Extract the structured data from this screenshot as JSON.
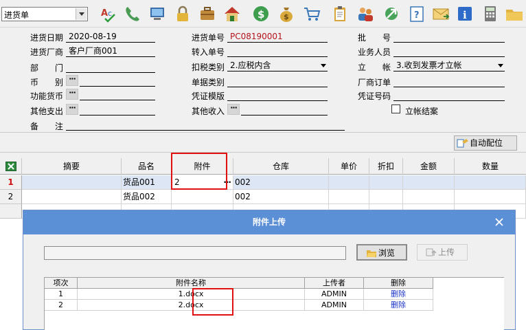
{
  "toolbar": {
    "doc_type": "进货单",
    "icons": [
      "spell-check-icon",
      "phone-icon",
      "monitor-icon",
      "lock-icon",
      "briefcase-icon",
      "house-icon",
      "dollar-icon",
      "money-bag-icon",
      "cart-icon",
      "clipboard-icon",
      "users-icon",
      "zoom-icon",
      "help-icon",
      "mail-icon",
      "info-icon",
      "calculator-icon",
      "folder-icon"
    ]
  },
  "form": {
    "purchase_date_label": "进货日期",
    "purchase_date": "2020-08-19",
    "vendor_label": "进货厂商",
    "vendor": "客户厂商001",
    "dept_label": "部　　门",
    "currency_label": "币　　别",
    "functional_currency_label": "功能货币",
    "other_expense_label": "其他支出",
    "remark_label": "备　　注",
    "order_no_label": "进货单号",
    "order_no": "PC08190001",
    "transfer_no_label": "转入单号",
    "tax_type_label": "扣税类别",
    "tax_type": "2.应税内含",
    "doc_category_label": "单据类别",
    "voucher_template_label": "凭证模版",
    "other_income_label": "其他收入",
    "batch_no_label": "批　　号",
    "sales_person_label": "业务人员",
    "account_label": "立　　帐",
    "account_value": "3.收到发票才立帐",
    "vendor_order_label": "厂商订单",
    "voucher_no_label": "凭证号码",
    "account_closed_label": "立帐结案",
    "dots": "···"
  },
  "strip": {
    "auto_alloc": "自动配位"
  },
  "grid": {
    "columns": [
      "摘要",
      "品名",
      "附件",
      "仓库",
      "单价",
      "折扣",
      "金额",
      "数量"
    ],
    "rows": [
      {
        "num": "1",
        "summary": "",
        "product": "货品001",
        "attachment": "2",
        "warehouse": "002"
      },
      {
        "num": "2",
        "summary": "",
        "product": "货品002",
        "attachment": "",
        "warehouse": "002"
      }
    ]
  },
  "dialog": {
    "title": "附件上传",
    "browse": "浏览",
    "upload": "上传",
    "columns": [
      "项次",
      "附件名称",
      "上传者",
      "删除"
    ],
    "files": [
      {
        "index": "1",
        "name": "1.docx",
        "uploader": "ADMIN",
        "action": "删除"
      },
      {
        "index": "2",
        "name": "2.docx",
        "uploader": "ADMIN",
        "action": "删除"
      }
    ]
  }
}
